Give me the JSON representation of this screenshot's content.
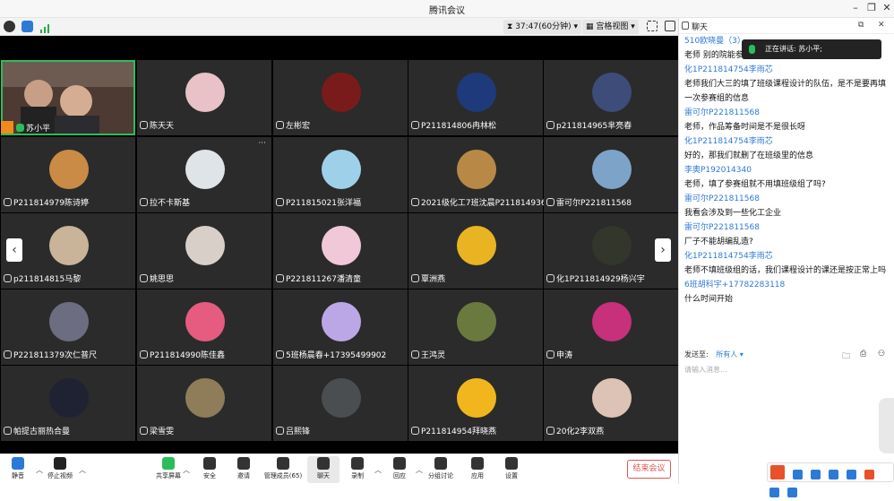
{
  "window": {
    "title": "腾讯会议"
  },
  "toolbar": {
    "timer": "37:47(60分钟)",
    "view": "宫格视图"
  },
  "tiles": [
    {
      "name": "苏小平",
      "speaking": true,
      "color": "#8a6e5d"
    },
    {
      "name": "陈天天",
      "color": "#e8c2c6"
    },
    {
      "name": "左彬宏",
      "color": "#7a1b1b"
    },
    {
      "name": "P211814806冉林松",
      "color": "#1f3a7a"
    },
    {
      "name": "p211814965芈亮春",
      "color": "#3d4c78"
    },
    {
      "name": "P211814979陈诗婷",
      "color": "#c98b45"
    },
    {
      "name": "拉不卡斯基",
      "color": "#dfe4e8"
    },
    {
      "name": "P211815021张洋福",
      "color": "#9fd0ea"
    },
    {
      "name": "2021级化工7班沈晨P211814936",
      "color": "#b88946"
    },
    {
      "name": "雷可尔P221811568",
      "color": "#7ea3c8"
    },
    {
      "name": "p211814815马黎",
      "color": "#c9b49a"
    },
    {
      "name": "姚思思",
      "color": "#d9cfc9"
    },
    {
      "name": "P221811267潘清童",
      "color": "#f0c8d8"
    },
    {
      "name": "覃洲燕",
      "color": "#e9b421"
    },
    {
      "name": "化1P211814929杨兴宇",
      "color": "#33362b"
    },
    {
      "name": "P221811379次仁普尺",
      "color": "#6c6d80"
    },
    {
      "name": "P211814990陈佳鑫",
      "color": "#e65b80"
    },
    {
      "name": "5班杨晨春+17395499902",
      "color": "#bca7e6"
    },
    {
      "name": "王鸿灵",
      "color": "#6a7a3e"
    },
    {
      "name": "申涛",
      "color": "#c7307a"
    },
    {
      "name": "帕提古丽热合曼",
      "color": "#1f2233"
    },
    {
      "name": "梁雪雯",
      "color": "#8f7d5a"
    },
    {
      "name": "吕熙锋",
      "color": "#4b4e50"
    },
    {
      "name": "P211814954拜晓燕",
      "color": "#f1b61e"
    },
    {
      "name": "20化2李双燕",
      "color": "#dcc3b5"
    }
  ],
  "controls": [
    {
      "label": "静音"
    },
    {
      "label": "停止视频"
    },
    {
      "label": "共享屏幕"
    },
    {
      "label": "安全"
    },
    {
      "label": "邀请"
    },
    {
      "label": "管理成员(65)"
    },
    {
      "label": "聊天"
    },
    {
      "label": "录制"
    },
    {
      "label": "回应"
    },
    {
      "label": "分组讨论"
    },
    {
      "label": "应用"
    },
    {
      "label": "设置"
    }
  ],
  "end_meeting_label": "结束会议",
  "chat": {
    "title": "聊天",
    "speaking_label": "正在讲话: 苏小平;",
    "messages": [
      {
        "sender": "510欧晓曼（3）",
        "text": "老师 别的院能参加吗"
      },
      {
        "sender": "化1P211814754李雨芯",
        "text": "老师我们大三的填了班级课程设计的队伍，是不是要再填一次参赛组的信息"
      },
      {
        "sender": "雷可尔P221811568",
        "text": "老师，作品筹备时间是不是很长呀"
      },
      {
        "sender": "化1P211814754李雨芯",
        "text": "好的，那我们就删了在班级里的信息"
      },
      {
        "sender": "李奥P192014340",
        "text": "老师，填了参赛组就不用填班级组了吗?"
      },
      {
        "sender": "雷可尔P221811568",
        "text": "我看会涉及到一些化工企业"
      },
      {
        "sender": "雷可尔P221811568",
        "text": "厂子不能胡编乱造?"
      },
      {
        "sender": "化1P211814754李雨芯",
        "text": "老师不填班级组的话，我们课程设计的课还是按正常上吗"
      },
      {
        "sender": "6班胡科宇+17782283118",
        "text": "什么时间开始"
      }
    ],
    "send_to_label": "发送至:",
    "send_to_value": "所有人",
    "input_placeholder": "请输入消息..."
  }
}
